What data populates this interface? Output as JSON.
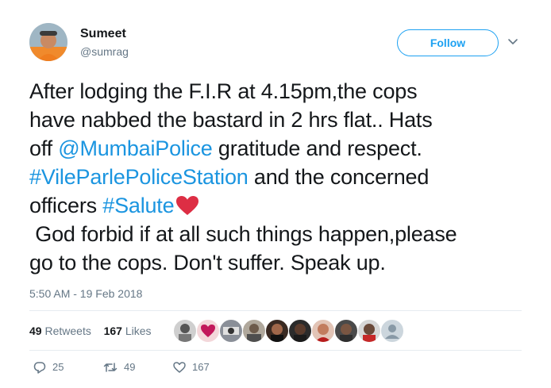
{
  "author": {
    "name": "Sumeet",
    "handle": "@sumrag",
    "avatar_icon": "user-avatar"
  },
  "follow_button_label": "Follow",
  "tweet_lines": [
    "After lodging the F.I.R at 4.15pm,the cops",
    "have nabbed the bastard in 2 hrs flat.. Hats",
    "off ",
    "@MumbaiPolice",
    " gratitude and respect.",
    "#VileParlePoliceStation",
    " and the concerned",
    "officers ",
    "#Salute",
    " God forbid if at all such things happen,please",
    "go to the cops. Don't suffer. Speak up."
  ],
  "timestamp": "5:50 AM - 19 Feb 2018",
  "stats": {
    "retweets_count": "49",
    "retweets_label": "Retweets",
    "likes_count": "167",
    "likes_label": "Likes"
  },
  "actions": {
    "reply_count": "25",
    "retweet_count": "49",
    "like_count": "167"
  },
  "colors": {
    "link": "#1b95e0",
    "accent": "#1da1f2",
    "text": "#14171a",
    "muted": "#657786",
    "heart": "#e0245e"
  }
}
